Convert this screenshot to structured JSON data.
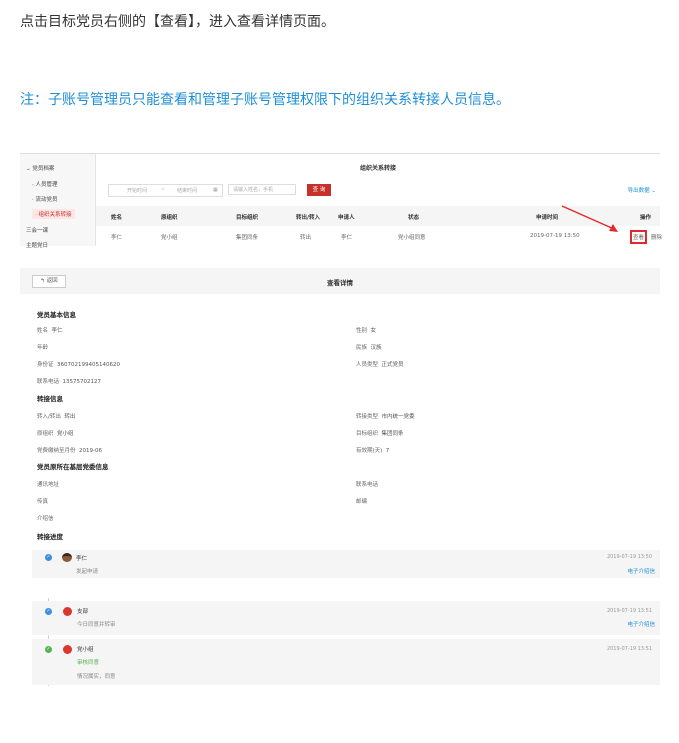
{
  "intro": "点击目标党员右侧的【查看】，进入查看详情页面。",
  "note": "注：子账号管理员只能查看和管理子账号管理权限下的组织关系转接人员信息。",
  "list_screen": {
    "sidebar": [
      "党员档案",
      "人员管理",
      "流动党员",
      "组织关系转接",
      "三会一课",
      "主题党日"
    ],
    "title": "组织关系转接",
    "start_date_placeholder": "开始时间",
    "separator": "~",
    "end_date_placeholder": "结束时间",
    "search_placeholder": "请输入姓名，手机",
    "search_button": "查 询",
    "export_label": "导出数据",
    "columns": [
      "姓名",
      "原组织",
      "目标组织",
      "转出/转入",
      "申请人",
      "状态",
      "申请时间",
      "操作"
    ],
    "row": {
      "name": "李仁",
      "from_org": "党小组",
      "target_org": "集团同条",
      "direction": "转出",
      "applicant": "李仁",
      "status": "党小组同意",
      "time": "2019-07-19 13:50",
      "view": "查看",
      "delete": "删除"
    }
  },
  "detail_screen": {
    "back_button": "返回",
    "title": "查看详情",
    "basic_section": "党员基本信息",
    "basic_left": [
      {
        "label": "姓名",
        "value": "李仁"
      },
      {
        "label": "年龄",
        "value": ""
      },
      {
        "label": "身份证",
        "value": "360702199405140620"
      },
      {
        "label": "联系电话",
        "value": "13575702127"
      }
    ],
    "basic_right": [
      {
        "label": "性别",
        "value": "女"
      },
      {
        "label": "民族",
        "value": "汉族"
      },
      {
        "label": "人员类型",
        "value": "正式党员"
      }
    ],
    "transfer_section": "转接信息",
    "transfer_left": [
      {
        "label": "转入/转出",
        "value": "转出"
      },
      {
        "label": "原组织",
        "value": "党小组"
      },
      {
        "label": "党费缴纳至月份",
        "value": "2019-06"
      }
    ],
    "transfer_right": [
      {
        "label": "转接类型",
        "value": "市内统一党委"
      },
      {
        "label": "目标组织",
        "value": "集团同条"
      },
      {
        "label": "有效期(天)",
        "value": "7"
      }
    ],
    "org_section": "党员原所在基层党委信息",
    "org_left": [
      {
        "label": "通讯地址",
        "value": ""
      },
      {
        "label": "传真",
        "value": ""
      },
      {
        "label": "介绍信",
        "value": ""
      }
    ],
    "org_right": [
      {
        "label": "联系电话",
        "value": ""
      },
      {
        "label": "邮编",
        "value": ""
      }
    ],
    "progress_section": "转接进度",
    "progress_first": {
      "name": "李仁",
      "status": "发起申请",
      "time": "2019-07-19 13:50",
      "link": "电子介绍信"
    }
  },
  "progress_screen": {
    "steps": [
      {
        "name": "支部",
        "status": "今日同意并转审",
        "time": "2019-07-19 13:51",
        "link": "电子介绍信",
        "dot": "#3b8de0"
      },
      {
        "name": "党小组",
        "status": "审核同意",
        "remark": "情况属实，同意",
        "time": "2019-07-19 13:51",
        "dot": "#52b352"
      }
    ]
  },
  "colors": {
    "accent": "#c6322a",
    "link": "#1e8fd6",
    "highlight": "#e12b2b"
  }
}
